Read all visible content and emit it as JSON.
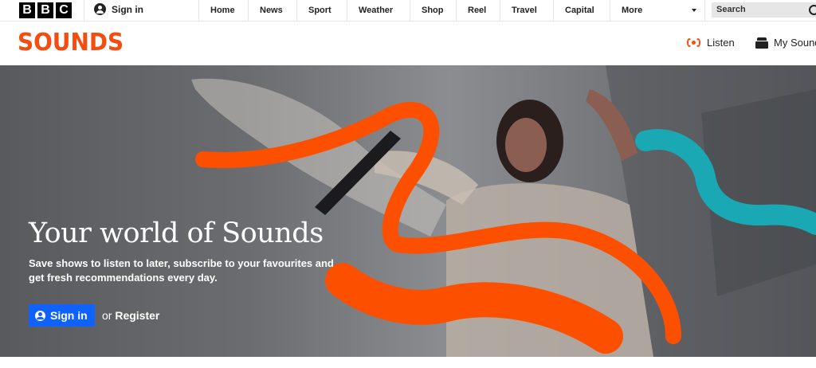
{
  "bbc_bar": {
    "logo_letters": [
      "B",
      "B",
      "C"
    ],
    "sign_in_label": "Sign in",
    "nav_items": [
      "Home",
      "News",
      "Sport",
      "Weather",
      "Shop",
      "Reel",
      "Travel",
      "Capital",
      "More"
    ],
    "search_placeholder": "Search"
  },
  "sounds_header": {
    "logo_text": "SOUNDS",
    "listen_label": "Listen",
    "my_sounds_label": "My Sounds"
  },
  "hero": {
    "title": "Your world of Sounds",
    "subtitle": "Save shows to listen to later, subscribe to your favourites and get fresh recommendations every day.",
    "sign_in_button": "Sign in",
    "or_text": "or",
    "register_link": "Register"
  },
  "colors": {
    "brand_orange": "#f54c0f",
    "teal_accent": "#19a8b4",
    "button_blue": "#0f62fe"
  },
  "icons": [
    "account-icon",
    "radio-wave-icon",
    "my-sounds-icon",
    "search-icon",
    "chevron-down-icon"
  ]
}
